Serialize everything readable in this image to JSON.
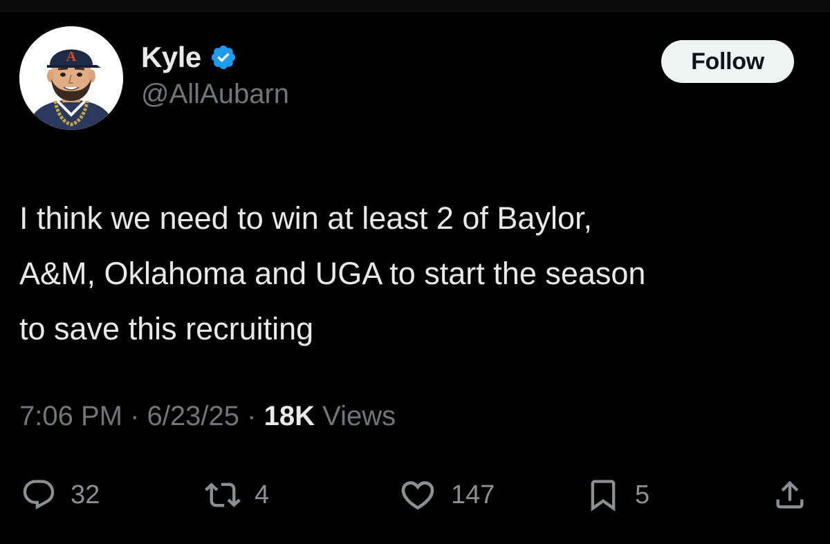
{
  "author": {
    "display_name": "Kyle",
    "handle": "@AllAubarn",
    "verified": true,
    "avatar_icon": "cartoon-avatar-icon",
    "avatar_cap_letter": "A"
  },
  "follow_button": {
    "label": "Follow"
  },
  "tweet": {
    "text": "I think we need to win at least 2 of Baylor,\nA&M, Oklahoma and UGA to start the season\nto save this recruiting"
  },
  "meta": {
    "time": "7:06 PM",
    "separator": "·",
    "date": "6/23/25",
    "views_count": "18K",
    "views_label": "Views"
  },
  "actions": {
    "replies": {
      "icon": "reply-icon",
      "count": "32"
    },
    "reposts": {
      "icon": "repost-icon",
      "count": "4"
    },
    "likes": {
      "icon": "heart-icon",
      "count": "147"
    },
    "bookmarks": {
      "icon": "bookmark-icon",
      "count": "5"
    },
    "share": {
      "icon": "share-icon"
    }
  },
  "colors": {
    "background": "#000000",
    "primary_text": "#e7e9ea",
    "secondary_text": "#71767b",
    "verified_blue": "#1d9bf0",
    "follow_bg": "#eff3f4"
  }
}
